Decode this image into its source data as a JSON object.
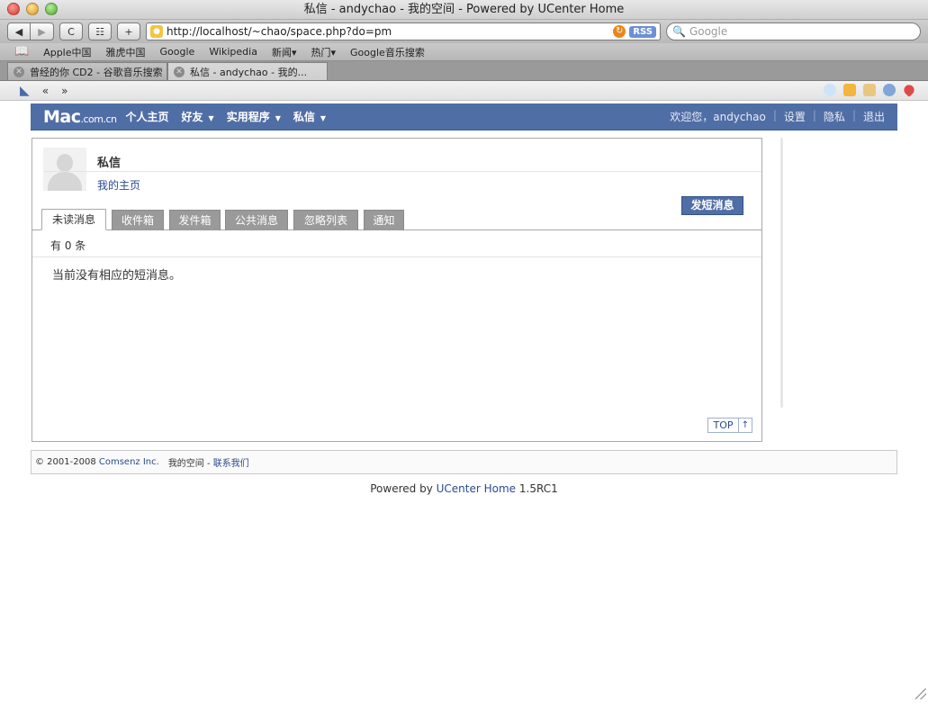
{
  "window": {
    "title": "私信 - andychao - 我的空间 - Powered by UCenter Home"
  },
  "toolbar": {
    "back_label": "◀",
    "forward_label": "▶",
    "reload_label": "C",
    "snapback_label": "☷",
    "add_label": "+",
    "url": "http://localhost/~chao/space.php?do=pm",
    "rss_label": "RSS",
    "search_placeholder": "Google"
  },
  "bookmarks": {
    "items": [
      "Apple中国",
      "雅虎中国",
      "Google",
      "Wikipedia",
      "新闻▾",
      "热门▾",
      "Google音乐搜索"
    ]
  },
  "browser_tabs": [
    {
      "label": "曾经的你 CD2 - 谷歌音乐搜索"
    },
    {
      "label": "私信 - andychao - 我的..."
    }
  ],
  "extbar": {
    "back_label": "«",
    "forward_label": "»"
  },
  "site_nav": {
    "logo_main": "Mac",
    "logo_sub": ".com.cn",
    "menu": [
      "个人主页",
      "好友",
      "实用程序",
      "私信"
    ],
    "welcome": "欢迎您，andychao",
    "settings": "设置",
    "privacy": "隐私",
    "logout": "退出",
    "sep": "|"
  },
  "pm_box": {
    "title": "私信",
    "home_link": "我的主页",
    "send_button": "发短消息",
    "tabs": [
      "未读消息",
      "收件箱",
      "发件箱",
      "公共消息",
      "忽略列表",
      "通知"
    ],
    "count_text": "有 0 条",
    "empty_text": "当前没有相应的短消息。",
    "top_label": "TOP",
    "top_arrow": "↑"
  },
  "footer": {
    "copyright": "© 2001-2008",
    "company": "Comsenz Inc.",
    "space": "我的空间 -",
    "contact": "联系我们"
  },
  "powered": {
    "prefix": "Powered by",
    "product": "UCenter Home",
    "version": "1.5RC1"
  }
}
